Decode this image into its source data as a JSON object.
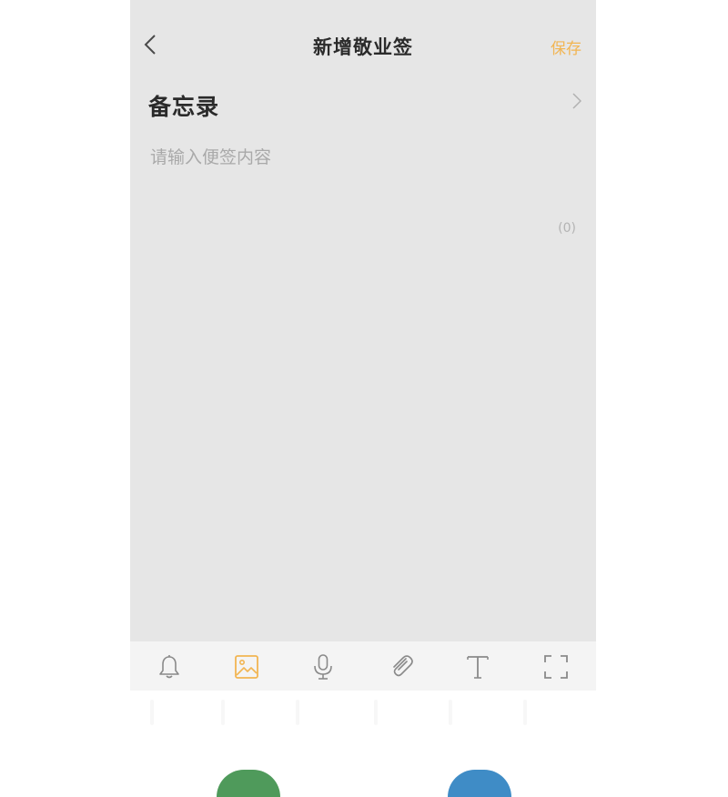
{
  "nav": {
    "title": "新增敬业签",
    "save_label": "保存",
    "back_icon": "chevron-left-icon"
  },
  "category": {
    "label": "备忘录",
    "chevron_icon": "chevron-right-icon"
  },
  "content": {
    "value": "",
    "placeholder": "请输入便签内容",
    "counter": "(0)"
  },
  "toolbar": {
    "items": [
      {
        "icon": "bell-icon",
        "active": false
      },
      {
        "icon": "image-icon",
        "active": true
      },
      {
        "icon": "microphone-icon",
        "active": false
      },
      {
        "icon": "paperclip-icon",
        "active": false
      },
      {
        "icon": "text-icon",
        "active": false
      },
      {
        "icon": "fullscreen-icon",
        "active": false
      }
    ]
  },
  "colors": {
    "background": "#e6e6e6",
    "accent": "#f2b552",
    "icon": "#8a8a8a",
    "toolbar": "#f4f4f4"
  }
}
